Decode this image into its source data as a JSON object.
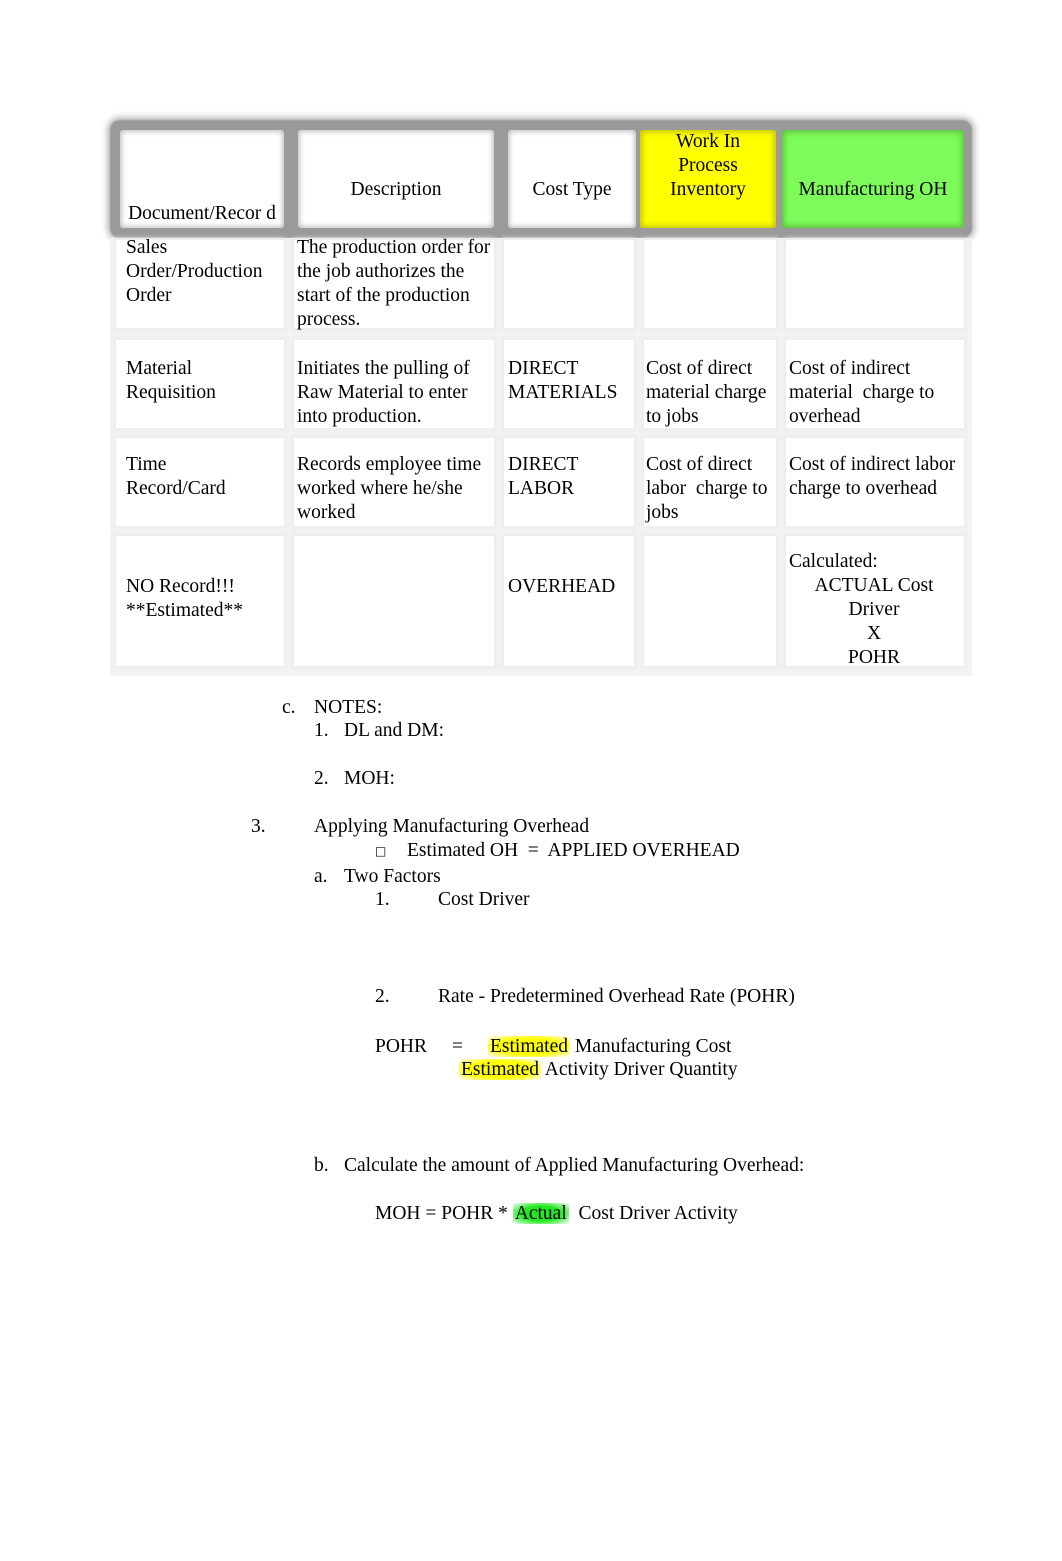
{
  "table": {
    "headers": [
      {
        "label": "Document/Recor d",
        "color": "#ffffff"
      },
      {
        "label": "Description",
        "color": "#ffffff"
      },
      {
        "label": "Cost Type",
        "color": "#ffffff"
      },
      {
        "label": "Work In Process Inventory",
        "color": "#ffff00"
      },
      {
        "label": "Manufacturing OH",
        "color": "#7dfb5a"
      }
    ],
    "rows": [
      {
        "document": "Sales Order/Production Order",
        "description": "The production order for the job authorizes the start of the production process.",
        "cost_type": "",
        "wip": "",
        "moh": ""
      },
      {
        "document": "Material Requisition",
        "description": "Initiates the pulling of Raw Material to enter into production.",
        "cost_type": "DIRECT MATERIALS",
        "wip": "Cost of direct material charge to jobs",
        "moh": "Cost of indirect material  charge to overhead"
      },
      {
        "document": "Time Record/Card",
        "description": "Records employee time worked where he/she worked",
        "cost_type": "DIRECT LABOR",
        "wip": "Cost of direct labor  charge to jobs",
        "moh": "Cost of indirect labor  charge to overhead"
      },
      {
        "document_lines": [
          "NO Record!!!",
          "**Estimated**"
        ],
        "description": "",
        "cost_type": "OVERHEAD",
        "wip": "",
        "moh_lines": [
          "Calculated:",
          "ACTUAL Cost",
          "Driver",
          "X",
          "POHR"
        ]
      }
    ]
  },
  "notes": {
    "marker": "c.",
    "title": "NOTES:",
    "items": [
      {
        "marker": "1.",
        "label": "DL and DM:"
      },
      {
        "marker": "2.",
        "label": "MOH:"
      }
    ]
  },
  "section3": {
    "marker": "3.",
    "title": "Applying Manufacturing Overhead",
    "bullet_glyph": "□",
    "bullet_text": "Estimated OH  =  APPLIED OVERHEAD",
    "a": {
      "marker": "a.",
      "title": "Two Factors",
      "items": [
        {
          "marker": "1.",
          "label": "Cost Driver"
        },
        {
          "marker": "2.",
          "label": "Rate - Predetermined Overhead Rate (POHR)"
        }
      ]
    },
    "formula_pohr": {
      "lhs": "POHR",
      "equals": "=",
      "numerator_highlight": "Estimated",
      "numerator_rest": " Manufacturing Cost",
      "denominator_highlight": "Estimated",
      "denominator_rest": " Activity Driver Quantity",
      "highlight_color": "#ffff00"
    },
    "b": {
      "marker": "b.",
      "title": "Calculate the amount of Applied Manufacturing Overhead:"
    },
    "formula_moh": {
      "prefix": "MOH = POHR * ",
      "highlight": "Actual",
      "suffix": "  Cost Driver Activity",
      "highlight_color": "#22e822"
    }
  }
}
